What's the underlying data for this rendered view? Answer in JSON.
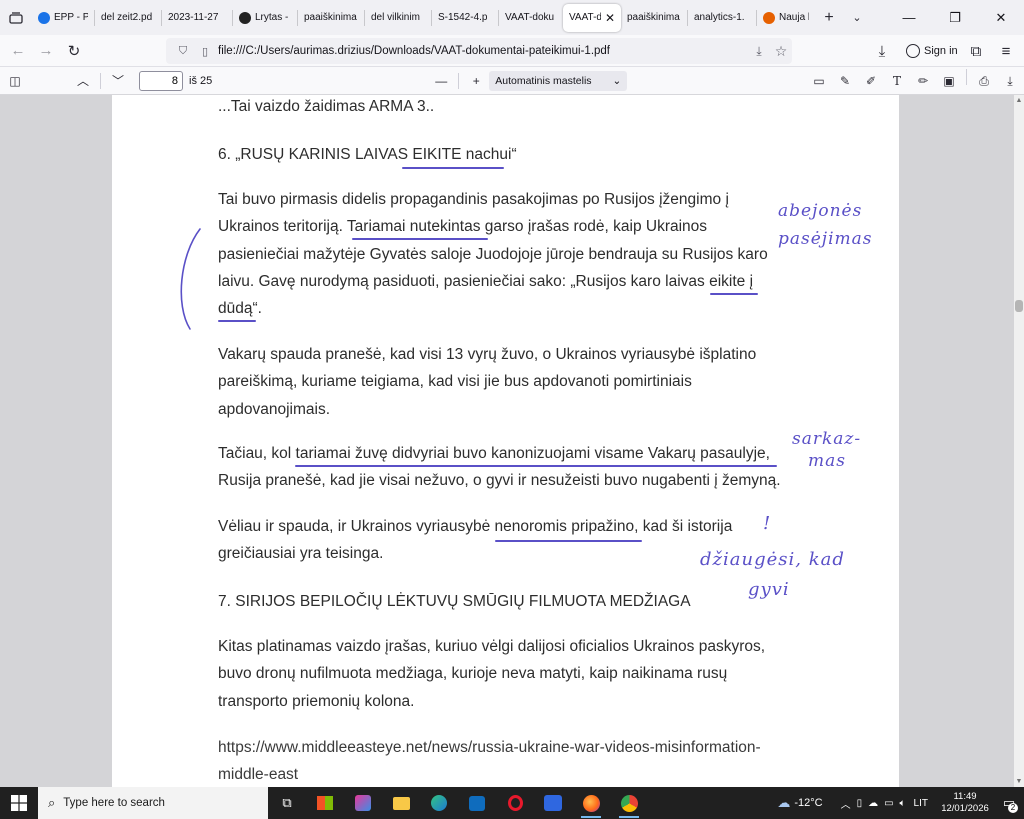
{
  "tabs": [
    {
      "label": "EPP - P",
      "color": "#1a73e8"
    },
    {
      "label": "del zeit2.pd",
      "color": ""
    },
    {
      "label": "2023-11-27",
      "color": ""
    },
    {
      "label": "Lrytas -",
      "color": "#222"
    },
    {
      "label": "paaiškinima",
      "color": ""
    },
    {
      "label": "del vilkinim",
      "color": ""
    },
    {
      "label": "S-1542-4.p",
      "color": ""
    },
    {
      "label": "VAAT-doku",
      "color": ""
    },
    {
      "label": "VAAT-do",
      "color": ""
    },
    {
      "label": "paaiškinima",
      "color": ""
    },
    {
      "label": "analytics-1.",
      "color": ""
    },
    {
      "label": "Nauja k",
      "color": "#e66000"
    }
  ],
  "active_tab_index": 8,
  "nav": {
    "url": "file:///C:/Users/aurimas.drizius/Downloads/VAAT-dokumentai-pateikimui-1.pdf",
    "signin": "Sign in"
  },
  "pdf": {
    "page": "8",
    "of_pages": "iš 25",
    "zoom": "Automatinis mastelis",
    "zoom_minus": "—",
    "zoom_plus": "+"
  },
  "doc": {
    "line_top": "...Tai vaizdo žaidimas  ARMA 3..",
    "h6": "6. „RUSŲ KARINIS LAIVAS EIKITE nachui“",
    "p1": [
      "Tai buvo pirmasis didelis propagandinis pasakojimas po Rusijos įžengimo į",
      "Ukrainos teritoriją. Tariamai nutekintas garso įrašas rodė, kaip Ukrainos",
      "pasieniečiai mažytėje Gyvatės saloje Juodojoje jūroje bendrauja su Rusijos karo",
      "laivu. Gavę nurodymą pasiduoti, pasieniečiai sako: „Rusijos karo laivas eikite į",
      "dūdą“."
    ],
    "p2": [
      "Vakarų spauda pranešė, kad visi 13 vyrų žuvo, o Ukrainos vyriausybė išplatino",
      "pareiškimą, kuriame teigiama, kad visi jie bus apdovanoti pomirtiniais",
      "apdovanojimais."
    ],
    "p3": [
      "Tačiau, kol tariamai žuvę didvyriai buvo kanonizuojami visame Vakarų pasaulyje,",
      "Rusija pranešė, kad jie visai nežuvo, o gyvi ir nesužeisti buvo nugabenti į žemyną."
    ],
    "p4": [
      "Vėliau ir spauda, ir Ukrainos vyriausybė nenoromis pripažino, kad ši istorija",
      "greičiausiai yra teisinga."
    ],
    "h7": "7. SIRIJOS BEPILOČIŲ LĖKTUVŲ SMŪGIŲ FILMUOTA MEDŽIAGA",
    "p5": [
      "Kitas platinamas vaizdo įrašas, kuriuo vėlgi dalijosi oficialios Ukrainos paskyros,",
      "buvo dronų nufilmuota medžiaga, kurioje neva matyti, kaip naikinama rusų",
      "transporto priemonių kolona."
    ],
    "link": [
      "https://www.middleeasteye.net/news/russia-ukraine-war-videos-misinformation-",
      "middle-east"
    ]
  },
  "handwriting": {
    "note1a": "abejonės",
    "note1b": "pasėjimas",
    "note2a": "sarkaz-",
    "note2b": "mas",
    "note3a": "!",
    "note3b": "džiaugėsi, kad",
    "note3c": "gyvi"
  },
  "taskbar": {
    "search_placeholder": "Type here to search",
    "weather": "-12°C",
    "lang": "LIT",
    "time": "11:49",
    "date": "12/01/2026",
    "notif_count": "2"
  }
}
